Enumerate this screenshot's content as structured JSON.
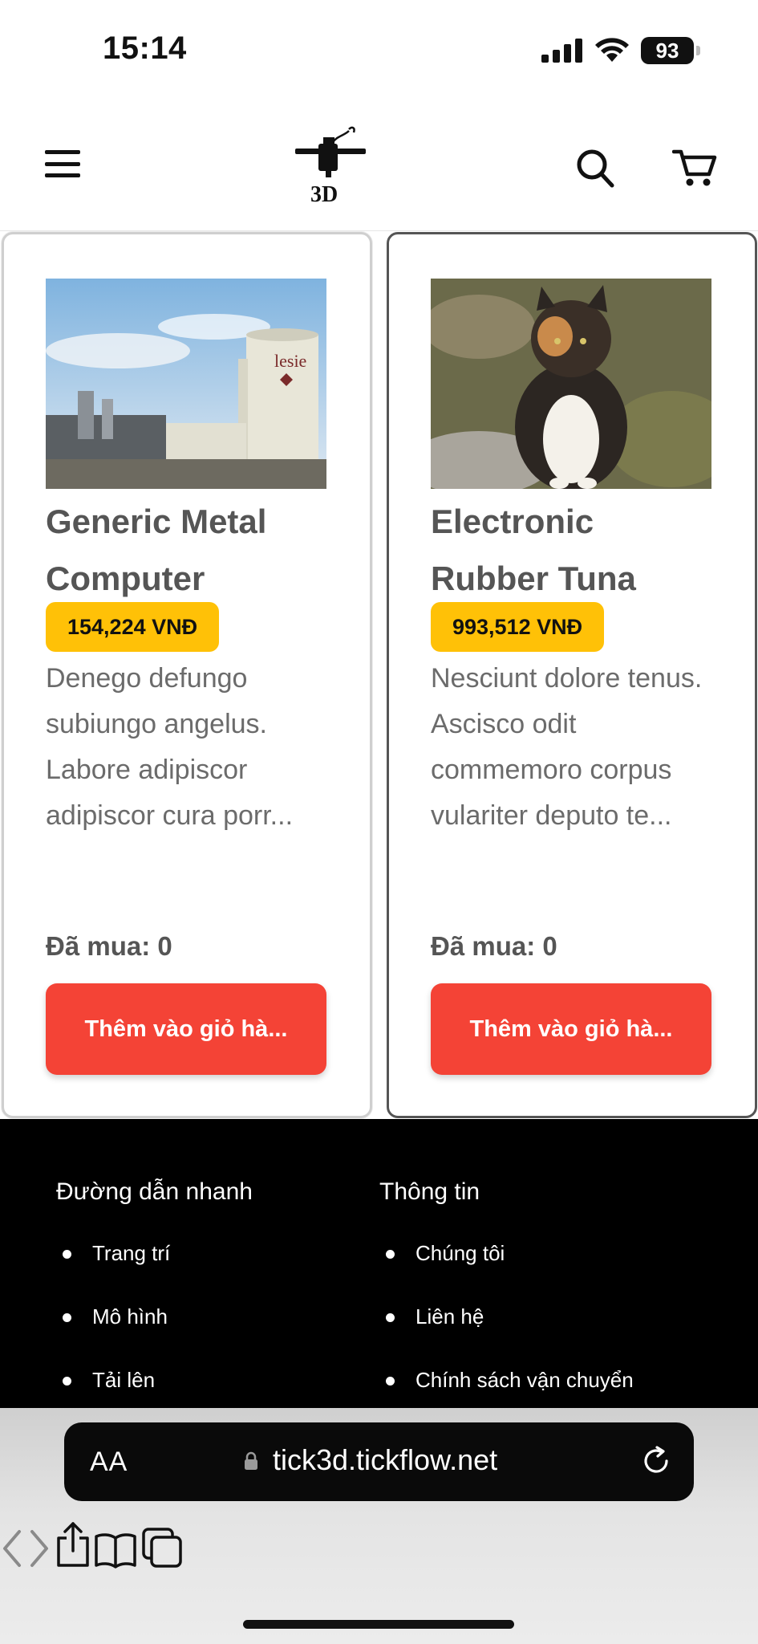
{
  "status_bar": {
    "time": "15:14",
    "battery": "93",
    "icons": [
      "cellular-signal-icon",
      "wifi-icon",
      "battery-icon"
    ]
  },
  "header": {
    "logo_text": "3D",
    "icons": [
      "hamburger-menu-icon",
      "search-icon",
      "cart-icon"
    ]
  },
  "products": [
    {
      "title": "Generic Metal Computer",
      "price": "154,224 VNĐ",
      "description": "Denego defungo subiungo angelus. Labore adipiscor adipiscor cura porr...",
      "bought": "Đã mua: 0",
      "add_label": "Thêm vào giỏ hà..."
    },
    {
      "title": "Electronic Rubber Tuna",
      "price": "993,512 VNĐ",
      "description": "Nesciunt dolore tenus. Ascisco odit commemoro corpus vulariter deputo te...",
      "bought": "Đã mua: 0",
      "add_label": "Thêm vào giỏ hà..."
    }
  ],
  "footer": {
    "quick_links": {
      "heading": "Đường dẫn nhanh",
      "items": [
        "Trang trí",
        "Mô hình",
        "Tải lên"
      ]
    },
    "info": {
      "heading": "Thông tin",
      "items": [
        "Chúng tôi",
        "Liên hệ",
        "Chính sách vận chuyển"
      ]
    }
  },
  "browser": {
    "text_size_label": "AA",
    "url": "tick3d.tickflow.net",
    "icons": [
      "lock-icon",
      "reload-icon",
      "back-icon",
      "forward-icon",
      "share-icon",
      "bookmarks-icon",
      "tabs-icon"
    ]
  },
  "colors": {
    "price_badge": "#ffc107",
    "add_button": "#f44336",
    "footer_bg": "#000000"
  }
}
